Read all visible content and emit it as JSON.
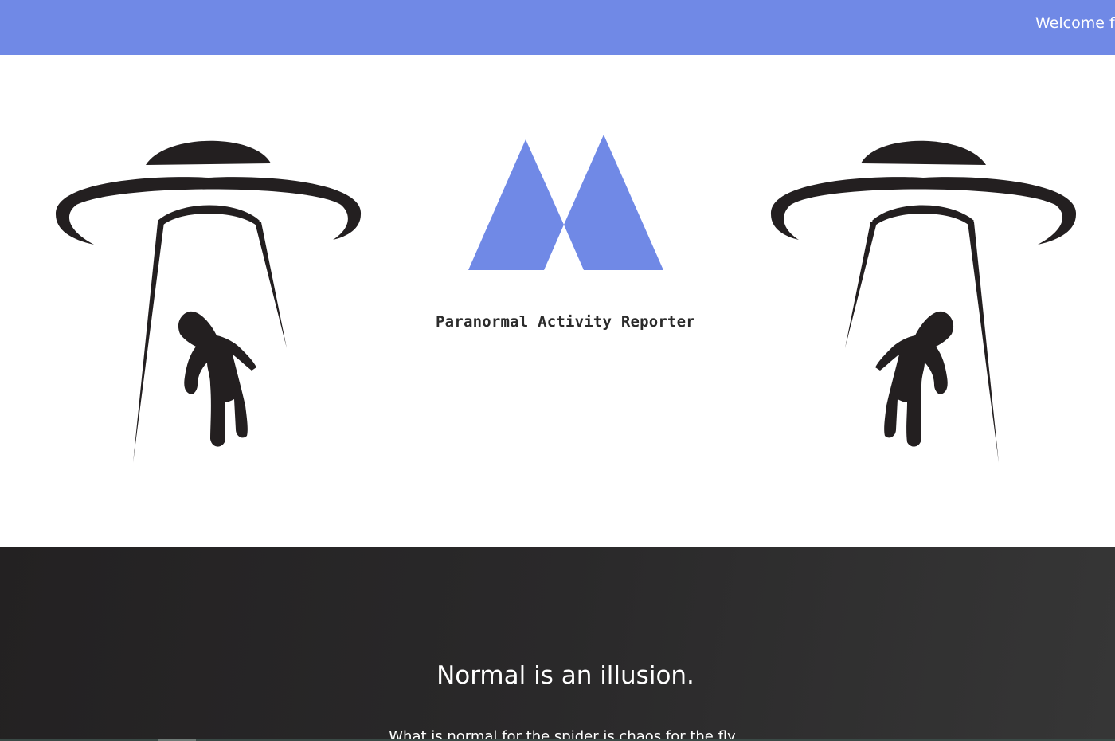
{
  "header": {
    "welcome_text": "Welcome  f"
  },
  "hero": {
    "app_title": "Paranormal Activity Reporter",
    "logo_color": "#7089e6",
    "icons": [
      "ufo-abduction-icon",
      "app-logo",
      "ufo-abduction-icon"
    ]
  },
  "quote_section": {
    "headline": "Normal is an illusion.",
    "quote": "What is normal for the spider is chaos for the fly."
  },
  "colors": {
    "accent": "#7089e6",
    "dark": "#2a292a",
    "ink": "#231f20"
  }
}
